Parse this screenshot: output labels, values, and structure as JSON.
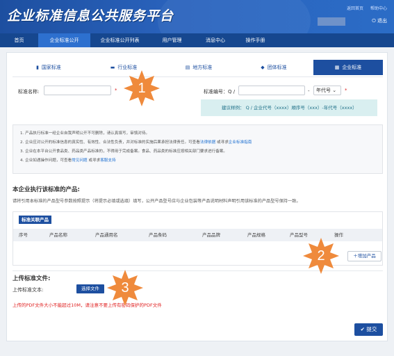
{
  "header": {
    "logo": "企业标准信息公共服务平台",
    "links": [
      "返回首页",
      "帮助中心"
    ],
    "logout": "退出"
  },
  "nav": [
    "首页",
    "企业标准公开",
    "企业标准公开列表",
    "用户管理",
    "消息中心",
    "操作手册"
  ],
  "tabs": [
    {
      "label": "国家标准",
      "icon": "book-icon"
    },
    {
      "label": "行业标准",
      "icon": "briefcase-icon"
    },
    {
      "label": "地方标准",
      "icon": "document-icon"
    },
    {
      "label": "团体标准",
      "icon": "shield-icon"
    },
    {
      "label": "企业标准",
      "icon": "bank-icon"
    }
  ],
  "form": {
    "name_label": "标准名称:",
    "code_label": "标准编号：Q /",
    "code_sep": "-",
    "year_select": "年代号",
    "hint": "建议样例： Q / 企业代号（xxxx）顺序号（xxx）-年代号（xxxx）"
  },
  "notes": [
    {
      "text": "1. 产品执行标准一经企业自我声明公开不可删除，请认真填写，审慎对待。"
    },
    {
      "text": "2. 企业应对公开的标准信息的真实性、有效性、合法性负责，并对标准的实施后果承担法律责任。可查看",
      "link": "法律依据",
      "text2": " 或寻求",
      "link2": "企业标准指南"
    },
    {
      "text": "3. 企业在本平台公开食品类、药品类产品标准的，不得用于完成备案。食品、药品类的标准应按相关部门要求进行备案。"
    },
    {
      "text": "4. 企业如遇操作问题，可查看",
      "link": "常见问题",
      "text2": " 或寻求",
      "link2": "客服支持"
    }
  ],
  "products": {
    "title": "本企业执行该标准的产品:",
    "desc": "请将引用本标准的产品型号参数按照提示（将提示必填或选填）填写，公开产品型号应与企业包装等产品说明材料声明引用该标准的产品型号保持一致。",
    "table_label": "标准关联产品",
    "columns": [
      "序号",
      "产品名称",
      "产品通用名",
      "产品条码",
      "产品品牌",
      "产品规格",
      "产品型号",
      "操作"
    ],
    "add_button": "增加产品"
  },
  "upload": {
    "title": "上传标准文件:",
    "file_label": "上传标准文本:",
    "choose_button": "选择文件",
    "warning": "上传的PDF文件大小不能超过10M，请注意不要上传有密码保护的PDF文件"
  },
  "submit": "提交",
  "markers": [
    "1",
    "2",
    "3"
  ],
  "colors": {
    "brand": "#1d4fa0",
    "marker": "#ef8a3c",
    "warning": "#e02020",
    "hint_bg": "#d9eff0"
  }
}
